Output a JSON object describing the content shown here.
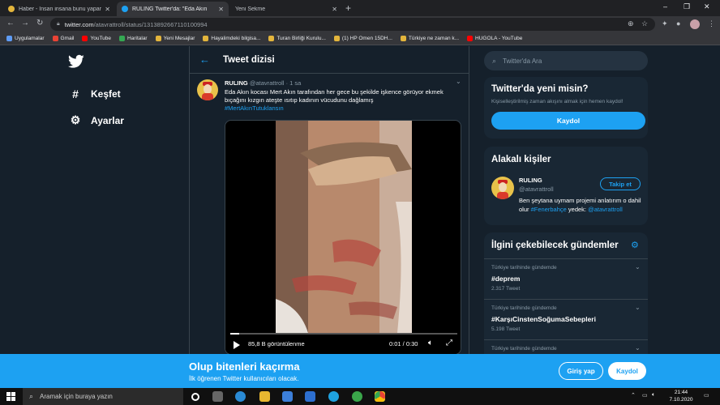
{
  "browser": {
    "tabs": [
      {
        "title": "Haber - İnsan insana bunu yapar",
        "active": false
      },
      {
        "title": "RULING Twitter'da: \"Eda Akın",
        "active": true
      },
      {
        "title": "Yeni Sekme",
        "active": false
      }
    ],
    "url_host": "twitter.com",
    "url_path": "/atavrattroll/status/1313892667110100994",
    "bookmarks": [
      "Uygulamalar",
      "Gmail",
      "YouTube",
      "Haritalar",
      "Yeni Mesajlar",
      "Hayalimdeki bilgisa...",
      "Turan Birliği Kurulu...",
      "(1) HP Omen 15DH...",
      "Türkiye ne zaman k...",
      "HUGOLA - YouTube"
    ]
  },
  "nav": {
    "explore": "Keşfet",
    "settings": "Ayarlar"
  },
  "thread": {
    "header": "Tweet dizisi",
    "tweet": {
      "name": "RULING",
      "handle": "@atavrattroll",
      "time": "· 1 sa",
      "text": "Eda Akın kocası Mert Akın tarafından her gece bu şekilde işkence görüyor ekmek bıçağını kızgın ateşte ısıtıp kadının vücudunu dağlamış",
      "hashtag": "#MertAkınTutuklansın",
      "video": {
        "views": "85,8 B görüntülenme",
        "time": "0:01 / 0:30",
        "progress": 0.04
      }
    }
  },
  "sidebar": {
    "search_placeholder": "Twitter'da Ara",
    "new_card": {
      "title": "Twitter'da yeni misin?",
      "subtitle": "Kişiselleştirilmiş zaman akışını almak için hemen kaydol!",
      "button": "Kaydol"
    },
    "related": {
      "title": "Alakalı kişiler",
      "name": "RULING",
      "handle": "@atavrattroll",
      "follow": "Takip et",
      "bio_pre": "Ben şeytana uymam projemi anlatırım o dahil olur",
      "bio_link": "#Fenerbahçe",
      "bio_mid": "yedek:",
      "bio_handle": "@atavrattroll"
    },
    "trends": {
      "title": "İlgini çekebilecek gündemler",
      "items": [
        {
          "context": "Türkiye tarihinde gündemde",
          "name": "#deprem",
          "count": "2.317 Tweet"
        },
        {
          "context": "Türkiye tarihinde gündemde",
          "name": "#KarşıCinstenSoğumaSebepleri",
          "count": "5.198 Tweet"
        },
        {
          "context": "Türkiye tarihinde gündemde",
          "name": "#",
          "count": ""
        }
      ]
    }
  },
  "banner": {
    "title": "Olup bitenleri kaçırma",
    "subtitle": "İlk öğrenen Twitter kullanıcıları olacak.",
    "login": "Giriş yap",
    "signup": "Kaydol"
  },
  "taskbar": {
    "search_placeholder": "Aramak için buraya yazın",
    "time": "21:44",
    "date": "7.10.2020"
  },
  "colors": {
    "bg": "#15202b",
    "card": "#192734",
    "accent": "#1da1f2"
  }
}
